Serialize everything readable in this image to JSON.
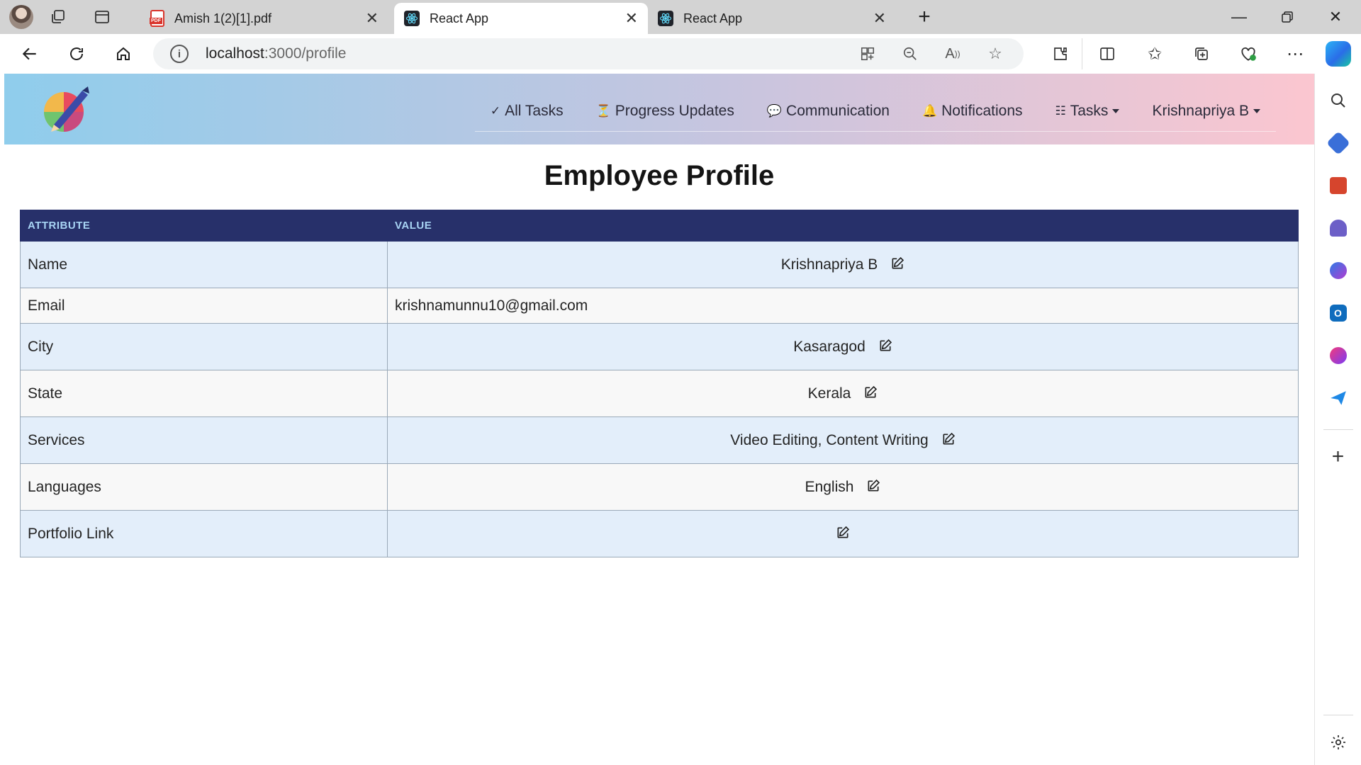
{
  "browser": {
    "tabs": [
      {
        "title": "Amish 1(2)[1].pdf",
        "icon": "pdf-icon",
        "active": false
      },
      {
        "title": "React App",
        "icon": "react-icon",
        "active": true
      },
      {
        "title": "React App",
        "icon": "react-icon",
        "active": false
      }
    ],
    "url_host": "localhost",
    "url_path": ":3000/profile"
  },
  "navbar": {
    "links": [
      {
        "icon": "✓",
        "label": "All Tasks"
      },
      {
        "icon": "⏳",
        "label": "Progress Updates"
      },
      {
        "icon": "💬",
        "label": "Communication"
      },
      {
        "icon": "🔔",
        "label": "Notifications"
      },
      {
        "icon": "☷",
        "label": "Tasks"
      },
      {
        "icon": "",
        "label": "Krishnapriya B"
      }
    ]
  },
  "page": {
    "title": "Employee Profile"
  },
  "table": {
    "headers": [
      "ATTRIBUTE",
      "VALUE"
    ],
    "rows": [
      {
        "attribute": "Name",
        "value": "Krishnapriya B",
        "editable": true
      },
      {
        "attribute": "Email",
        "value": "krishnamunnu10@gmail.com",
        "editable": false
      },
      {
        "attribute": "City",
        "value": "Kasaragod",
        "editable": true
      },
      {
        "attribute": "State",
        "value": "Kerala",
        "editable": true
      },
      {
        "attribute": "Services",
        "value": "Video Editing, Content Writing",
        "editable": true
      },
      {
        "attribute": "Languages",
        "value": "English",
        "editable": true
      },
      {
        "attribute": "Portfolio Link",
        "value": "",
        "editable": true
      }
    ]
  },
  "colors": {
    "table_header_bg": "#27306a",
    "table_header_text": "#a8d4f4",
    "row_odd": "#e3eefa",
    "row_even": "#f8f8f8",
    "navbar_gradient_start": "#8fcdec",
    "navbar_gradient_end": "#fbc6d0"
  }
}
